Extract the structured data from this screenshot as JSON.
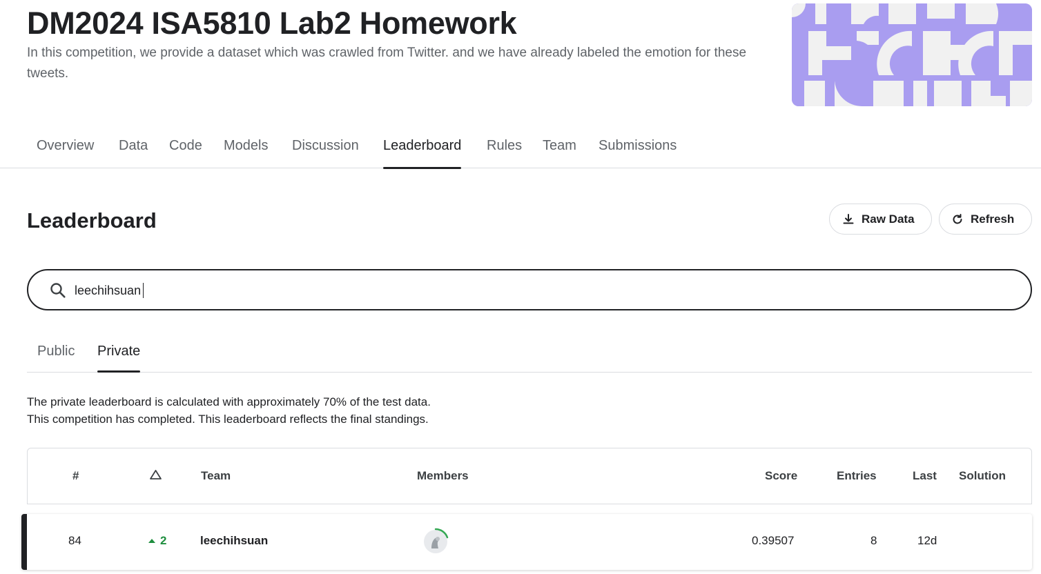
{
  "competition": {
    "title": "DM2024 ISA5810 Lab2 Homework",
    "description": "In this competition, we provide a dataset which was crawled from Twitter. and we have already labeled the emotion for these tweets."
  },
  "nav": {
    "tabs": [
      "Overview",
      "Data",
      "Code",
      "Models",
      "Discussion",
      "Leaderboard",
      "Rules",
      "Team",
      "Submissions"
    ],
    "active": "Leaderboard"
  },
  "leaderboard": {
    "heading": "Leaderboard",
    "raw_data_label": "Raw Data",
    "refresh_label": "Refresh",
    "search_value": "leechihsuan",
    "subtabs": [
      "Public",
      "Private"
    ],
    "active_subtab": "Private",
    "note_line1": "The private leaderboard is calculated with approximately 70% of the test data.",
    "note_line2": "This competition has completed. This leaderboard reflects the final standings.",
    "columns": {
      "rank": "#",
      "team": "Team",
      "members": "Members",
      "score": "Score",
      "entries": "Entries",
      "last": "Last",
      "solution": "Solution"
    },
    "rows": [
      {
        "rank": "84",
        "delta": "2",
        "team": "leechihsuan",
        "score": "0.39507",
        "entries": "8",
        "last": "12d"
      }
    ]
  },
  "colors": {
    "banner_bg": "#a99df0",
    "banner_shape": "#f1f1f1",
    "delta_up": "#1e8e3e",
    "active_underline": "#202124"
  },
  "icons": {
    "search": "search-icon",
    "download": "download-icon",
    "refresh": "refresh-icon",
    "delta_header": "triangle-outline-icon",
    "delta_up": "caret-up-icon"
  }
}
